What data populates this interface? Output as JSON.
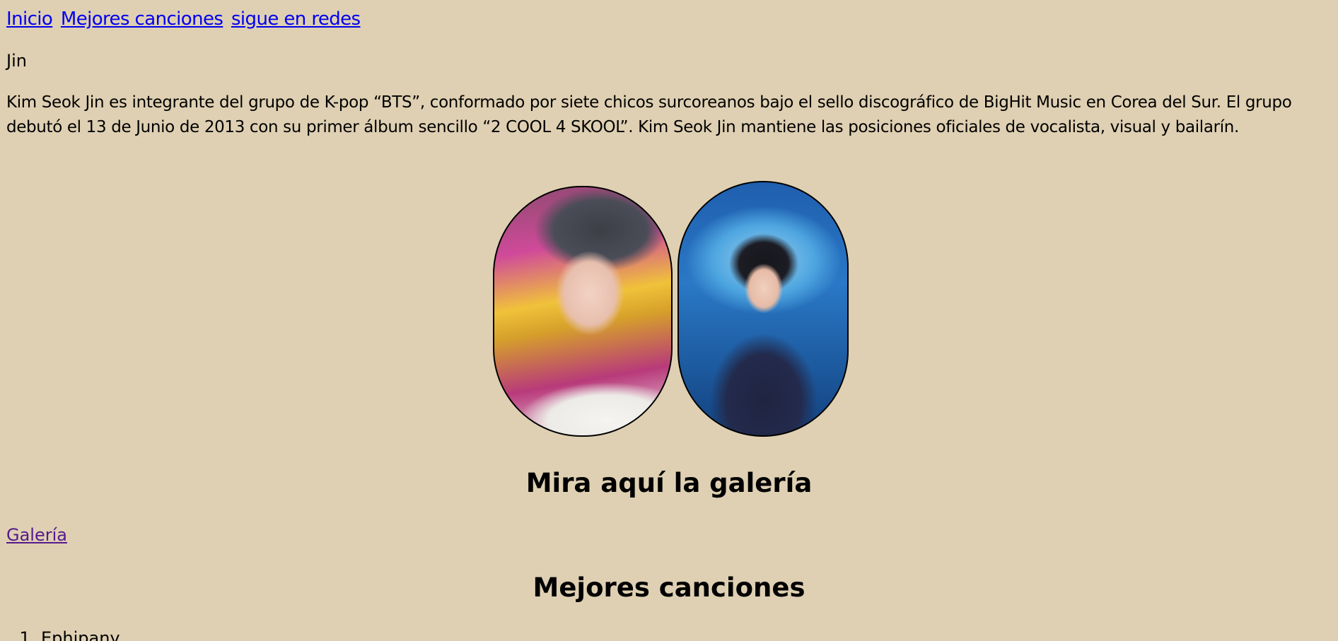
{
  "nav": {
    "links": [
      {
        "label": "Inicio"
      },
      {
        "label": "Mejores canciones"
      },
      {
        "label": "sigue en redes"
      }
    ]
  },
  "artist": {
    "name": "Jin",
    "bio": "Kim Seok Jin es integrante del grupo de K-pop “BTS”, conformado por siete chicos surcoreanos bajo el sello discográfico de BigHit Music en Corea del Sur. El grupo debutó el 13 de Junio de 2013 con su primer álbum sencillo “2 COOL 4 SKOOL”. Kim Seok Jin mantiene las posiciones oficiales de vocalista, visual y bailarín."
  },
  "gallery": {
    "title": "Mira aquí la galería",
    "link_label": "Galería"
  },
  "songs": {
    "title": "Mejores canciones",
    "items": [
      "Ephipany"
    ]
  },
  "colors": {
    "background": "#dfd0b3",
    "link": "#0000ee",
    "visited_link": "#551a8b"
  }
}
